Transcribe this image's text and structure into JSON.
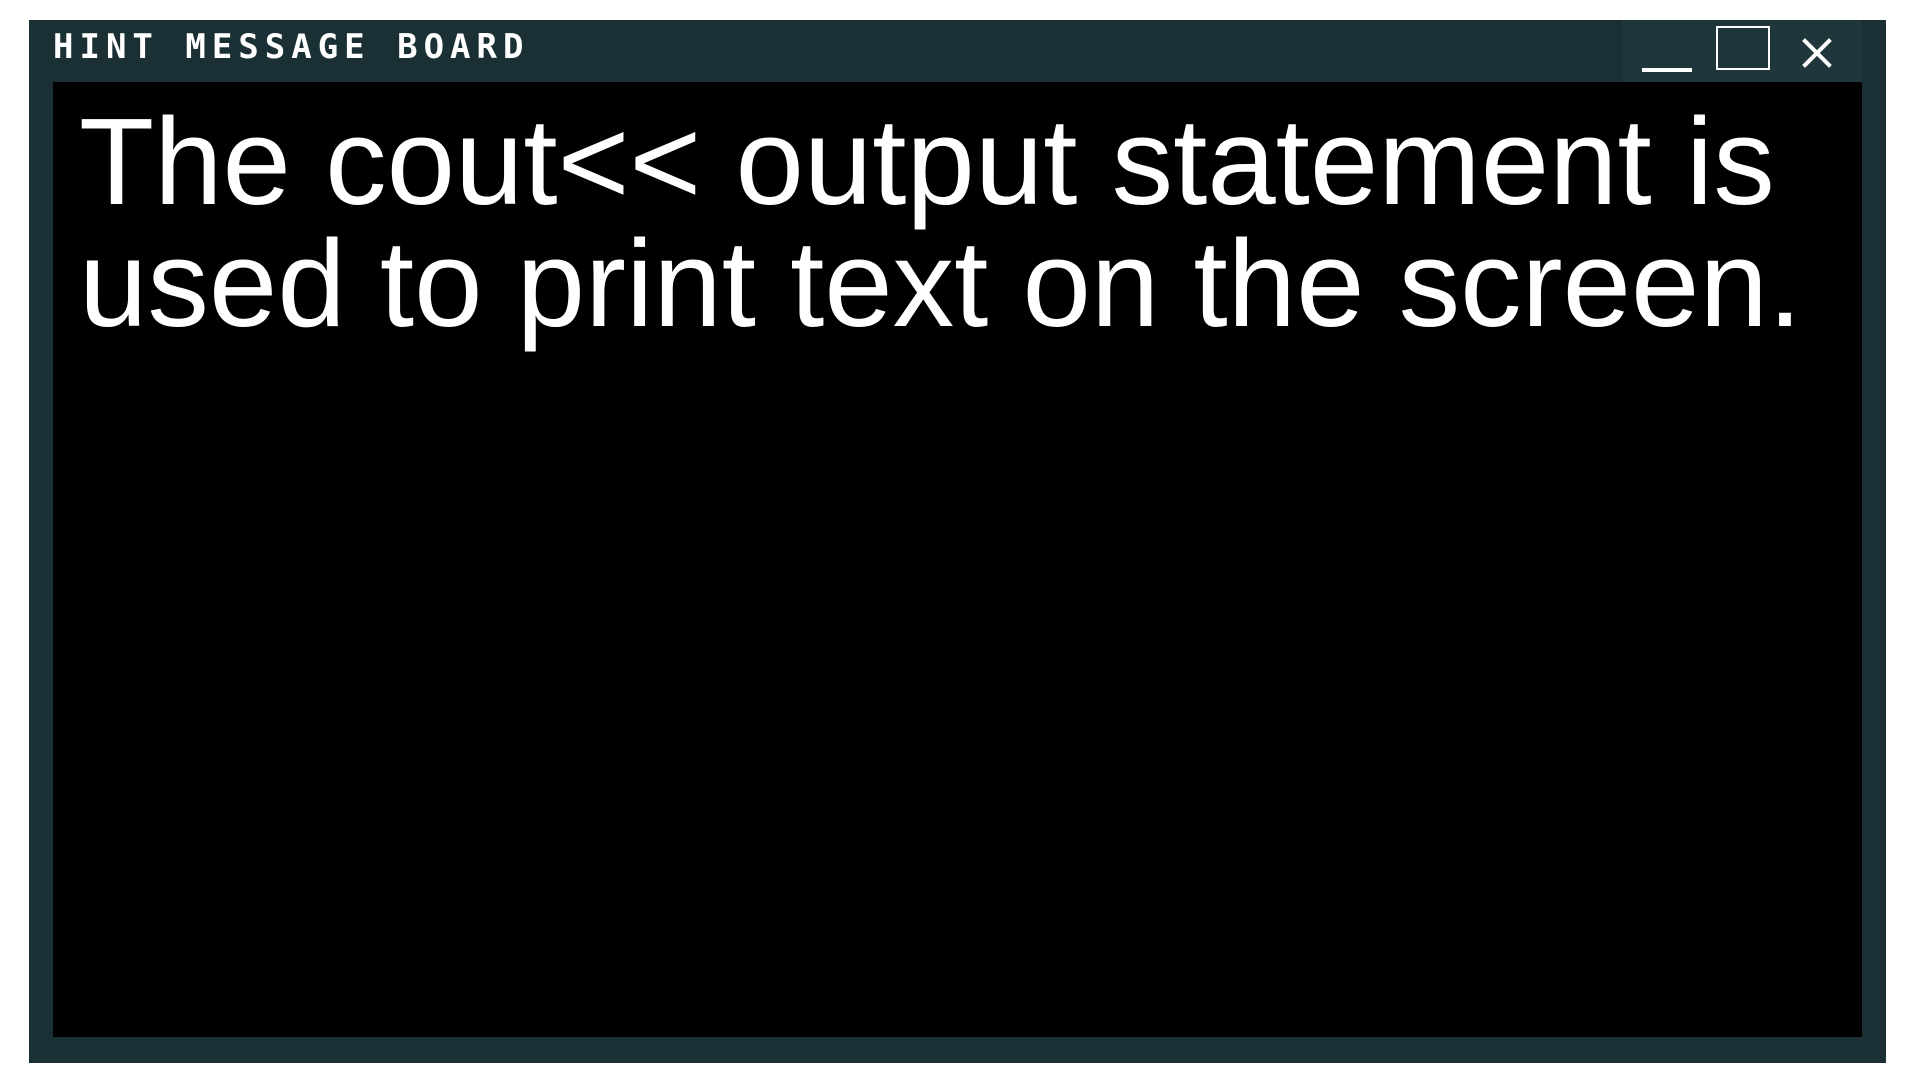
{
  "window": {
    "title": "HINT MESSAGE BOARD",
    "controls": {
      "minimize": "minimize-icon",
      "maximize": "maximize-icon",
      "close": "close-icon"
    },
    "colors": {
      "frame": "#1b3034",
      "content_bg": "#000000",
      "text": "#ffffff"
    }
  },
  "message": {
    "text": "The cout<< output statement is used to print text on the screen."
  }
}
